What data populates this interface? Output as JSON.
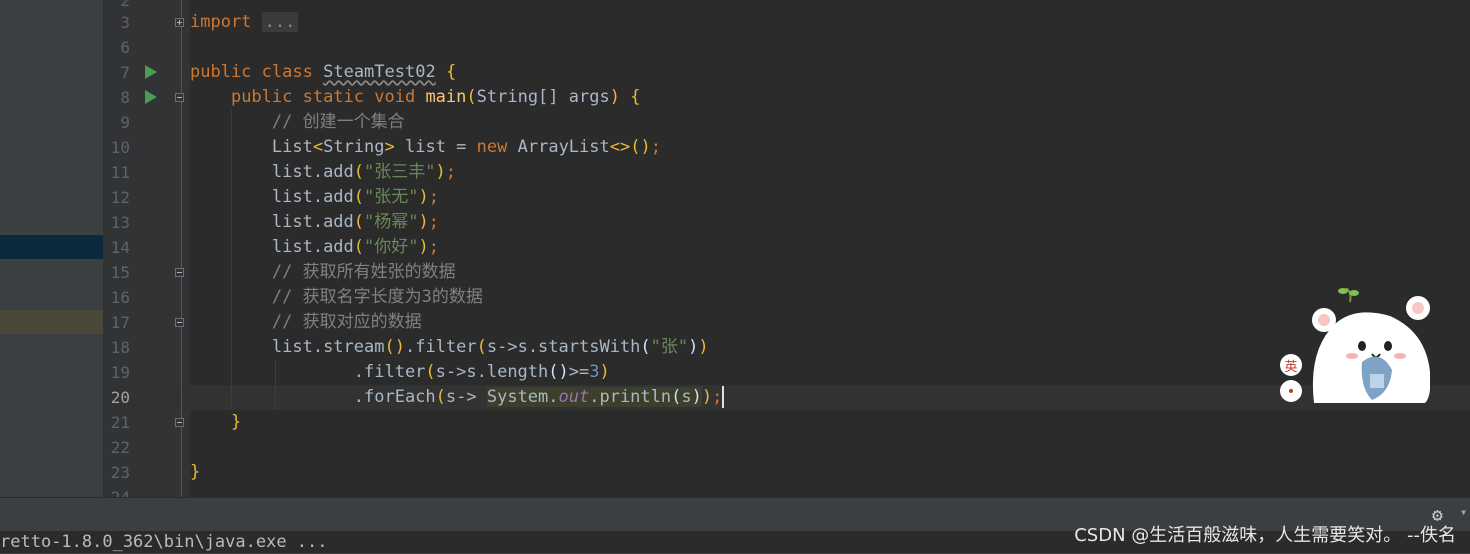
{
  "gutter": {
    "line_numbers": [
      "2",
      "3",
      "6",
      "7",
      "8",
      "9",
      "10",
      "11",
      "12",
      "13",
      "14",
      "15",
      "16",
      "17",
      "18",
      "19",
      "20",
      "21",
      "22",
      "23",
      "24"
    ],
    "active_line": "20"
  },
  "code": {
    "l3_import": "import",
    "l3_folded": "...",
    "l7_public": "public",
    "l7_class": "class",
    "l7_name": "SteamTest02",
    "l7_brace": "{",
    "l8_mods": "public static void",
    "l8_method": "main",
    "l8_paren_open": "(",
    "l8_params": "String[] args",
    "l8_paren_close": ")",
    "l8_brace": "{",
    "l9_comment": "// 创建一个集合",
    "l10_type": "List",
    "l10_generic_open": "<",
    "l10_generic_type": "String",
    "l10_generic_close": ">",
    "l10_decl": " list = ",
    "l10_new": "new",
    "l10_class": "ArrayList",
    "l10_diamond": "<>",
    "l10_parens": "()",
    "l10_semi": ";",
    "l11_call": "list.add",
    "l11_arg": "\"张三丰\"",
    "l12_call": "list.add",
    "l12_arg": "\"张无\"",
    "l13_call": "list.add",
    "l13_arg": "\"杨幂\"",
    "l14_call": "list.add",
    "l14_arg": "\"你好\"",
    "l15_comment": "// 获取所有姓张的数据",
    "l16_comment": "// 获取名字长度为3的数据",
    "l17_comment": "// 获取对应的数据",
    "l18_a": "list.stream",
    "l18_b": ".filter",
    "l18_c": "s->s.startsWith",
    "l18_arg": "\"张\"",
    "l19_a": ".filter",
    "l19_b": "s->s.length",
    "l19_c": ">=",
    "l19_num": "3",
    "l20_a": ".forEach",
    "l20_b": "s-> ",
    "l20_system": "System.",
    "l20_out": "out",
    "l20_println": ".println",
    "l20_s": "s",
    "l21_brace": "}",
    "l23_brace": "}"
  },
  "run_panel": {
    "command_text": "retto-1.8.0_362\\bin\\java.exe ..."
  },
  "watermark": "CSDN @生活百般滋味，人生需要笑对。 --佚名",
  "mascot": {
    "badge_top": "英",
    "badge_bottom": "•"
  },
  "icons": {
    "settings": "gear-icon",
    "run_gutter": "run-icon"
  },
  "colors": {
    "editor_bg": "#2b2b2b",
    "keyword": "#cc7832",
    "string": "#6a8759",
    "comment": "#808080",
    "number": "#6897bb",
    "method": "#ffc66d"
  }
}
